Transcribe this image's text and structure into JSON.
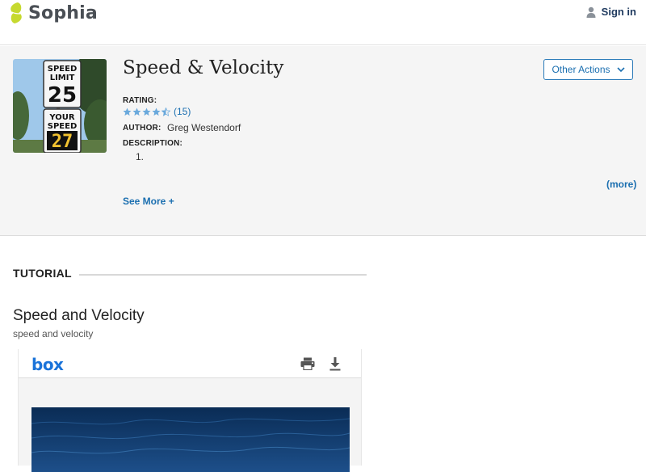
{
  "header": {
    "brand": "Sophia",
    "sign_in": "Sign in"
  },
  "resource": {
    "title": "Speed & Velocity",
    "thumbnail_sign": {
      "speed_limit_line1": "SPEED",
      "speed_limit_line2": "LIMIT",
      "speed_limit_value": "25",
      "your_speed_line1": "YOUR",
      "your_speed_line2": "SPEED",
      "your_speed_value": "27"
    },
    "other_actions_label": "Other Actions",
    "rating_label": "RATING:",
    "rating_stars": 4.5,
    "rating_count": "(15)",
    "author_label": "AUTHOR:",
    "author_name": "Greg Westendorf",
    "description_label": "DESCRIPTION:",
    "description_items": [
      "1."
    ],
    "more_link": "(more)",
    "see_more": "See More +"
  },
  "tutorial": {
    "section_label": "TUTORIAL",
    "title": "Speed and Velocity",
    "subtitle": "speed and velocity"
  },
  "viewer": {
    "logo": "box",
    "icons": [
      "print-icon",
      "download-icon"
    ]
  },
  "colors": {
    "accent": "#1b6fb0",
    "brand_green": "#c6d92f",
    "star": "#6aa9dc"
  }
}
